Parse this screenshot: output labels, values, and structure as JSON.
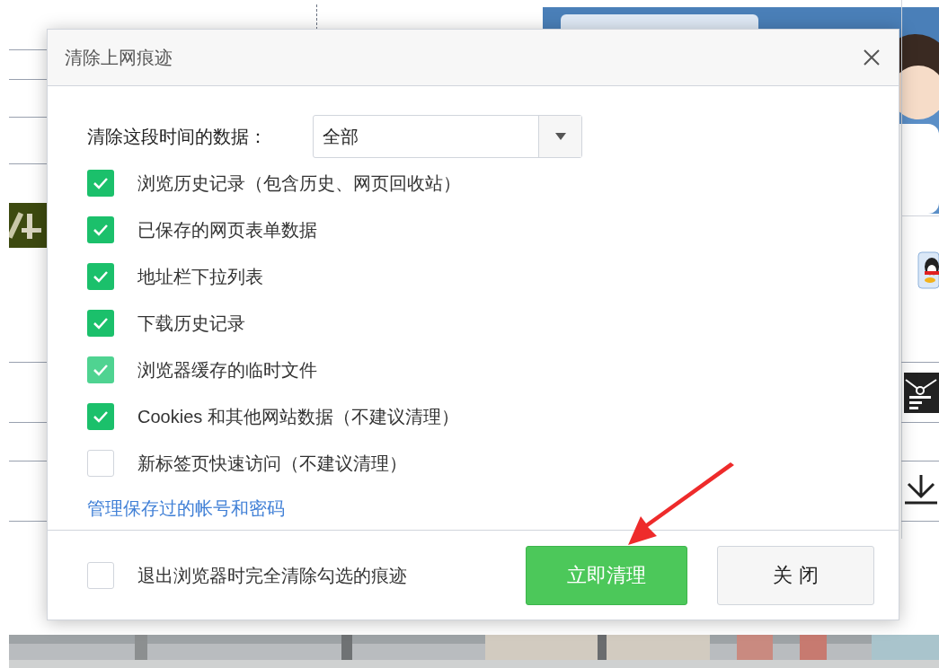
{
  "dialog": {
    "title": "清除上网痕迹",
    "time_range": {
      "label": "清除这段时间的数据：",
      "value": "全部"
    },
    "items": [
      {
        "label": "浏览历史记录（包含历史、网页回收站）",
        "checked": true,
        "highlighted": false
      },
      {
        "label": "已保存的网页表单数据",
        "checked": true,
        "highlighted": false
      },
      {
        "label": "地址栏下拉列表",
        "checked": true,
        "highlighted": false
      },
      {
        "label": "下载历史记录",
        "checked": true,
        "highlighted": false
      },
      {
        "label": "浏览器缓存的临时文件",
        "checked": true,
        "highlighted": true
      },
      {
        "label": "Cookies 和其他网站数据（不建议清理）",
        "checked": true,
        "highlighted": false
      },
      {
        "label": "新标签页快速访问（不建议清理）",
        "checked": false,
        "highlighted": false
      }
    ],
    "link": "管理保存过的帐号和密码",
    "exit_option": {
      "label": "退出浏览器时完全清除勾选的痕迹",
      "checked": false
    },
    "buttons": [
      {
        "label": "立即清理",
        "kind": "primary"
      },
      {
        "label": "关 闭",
        "kind": "secondary"
      }
    ]
  }
}
